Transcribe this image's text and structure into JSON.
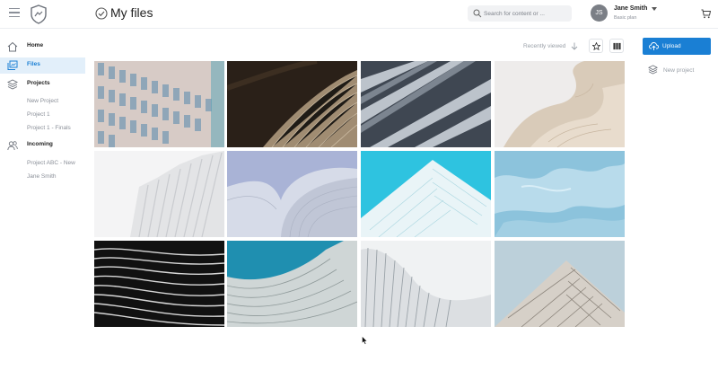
{
  "header": {
    "page_title": "My files",
    "search_placeholder": "Search for content or ...",
    "user": {
      "initials": "JS",
      "name": "Jane Smith",
      "plan": "Basic plan"
    }
  },
  "sidebar": {
    "items": [
      {
        "label": "Home",
        "icon": "home-icon"
      },
      {
        "label": "Files",
        "icon": "files-icon",
        "active": true
      },
      {
        "label": "Projects",
        "icon": "layers-icon"
      },
      {
        "label": "Incoming",
        "icon": "users-icon"
      }
    ],
    "projects": [
      "New Project",
      "Project 1",
      "Project 1 - Finals"
    ],
    "incoming": [
      "Project ABC - New",
      "Jane Smith"
    ]
  },
  "toolbar": {
    "sort_label": "Recently viewed",
    "upload_label": "Upload",
    "new_project_label": "New project"
  },
  "colors": {
    "accent": "#1a7fd4",
    "active_bg": "#e2effa"
  },
  "grid": {
    "tiles": [
      "facade-windows",
      "wood-slats",
      "steel-beams",
      "white-curves",
      "white-fins",
      "curved-silver",
      "cyan-tower",
      "blue-ice",
      "black-waves",
      "teal-curve",
      "white-ribs",
      "pyramid-balconies"
    ]
  }
}
